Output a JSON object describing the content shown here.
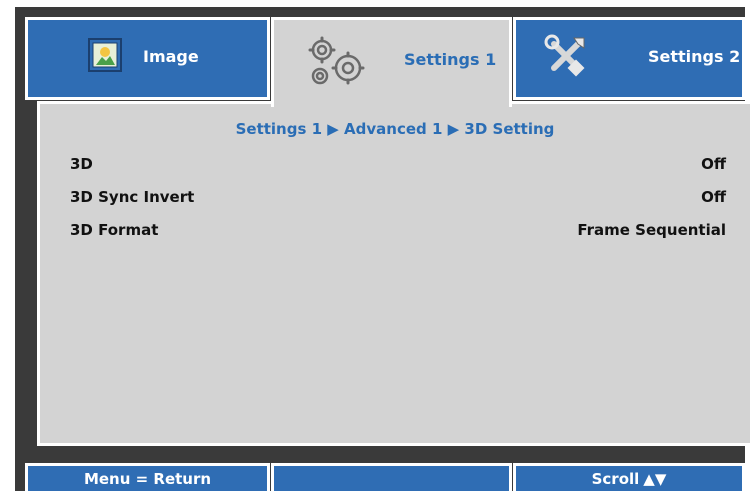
{
  "tabs": [
    {
      "label": "Image",
      "icon": "image-icon",
      "active": false
    },
    {
      "label": "Settings 1",
      "icon": "gears-icon",
      "active": true
    },
    {
      "label": "Settings 2",
      "icon": "tools-icon",
      "active": false
    }
  ],
  "breadcrumb": "Settings 1 ▶ Advanced 1 ▶ 3D Setting",
  "rows": [
    {
      "label": "3D",
      "value": "Off"
    },
    {
      "label": "3D Sync Invert",
      "value": "Off"
    },
    {
      "label": "3D Format",
      "value": "Frame Sequential"
    }
  ],
  "footer": {
    "left": "Menu = Return",
    "middle": "",
    "right": "Scroll",
    "arrows": "▲▼"
  },
  "colors": {
    "accent": "#2f6db4",
    "panel": "#d3d3d3",
    "frame": "#3a3a3a",
    "active_text": "#2a6db5"
  }
}
